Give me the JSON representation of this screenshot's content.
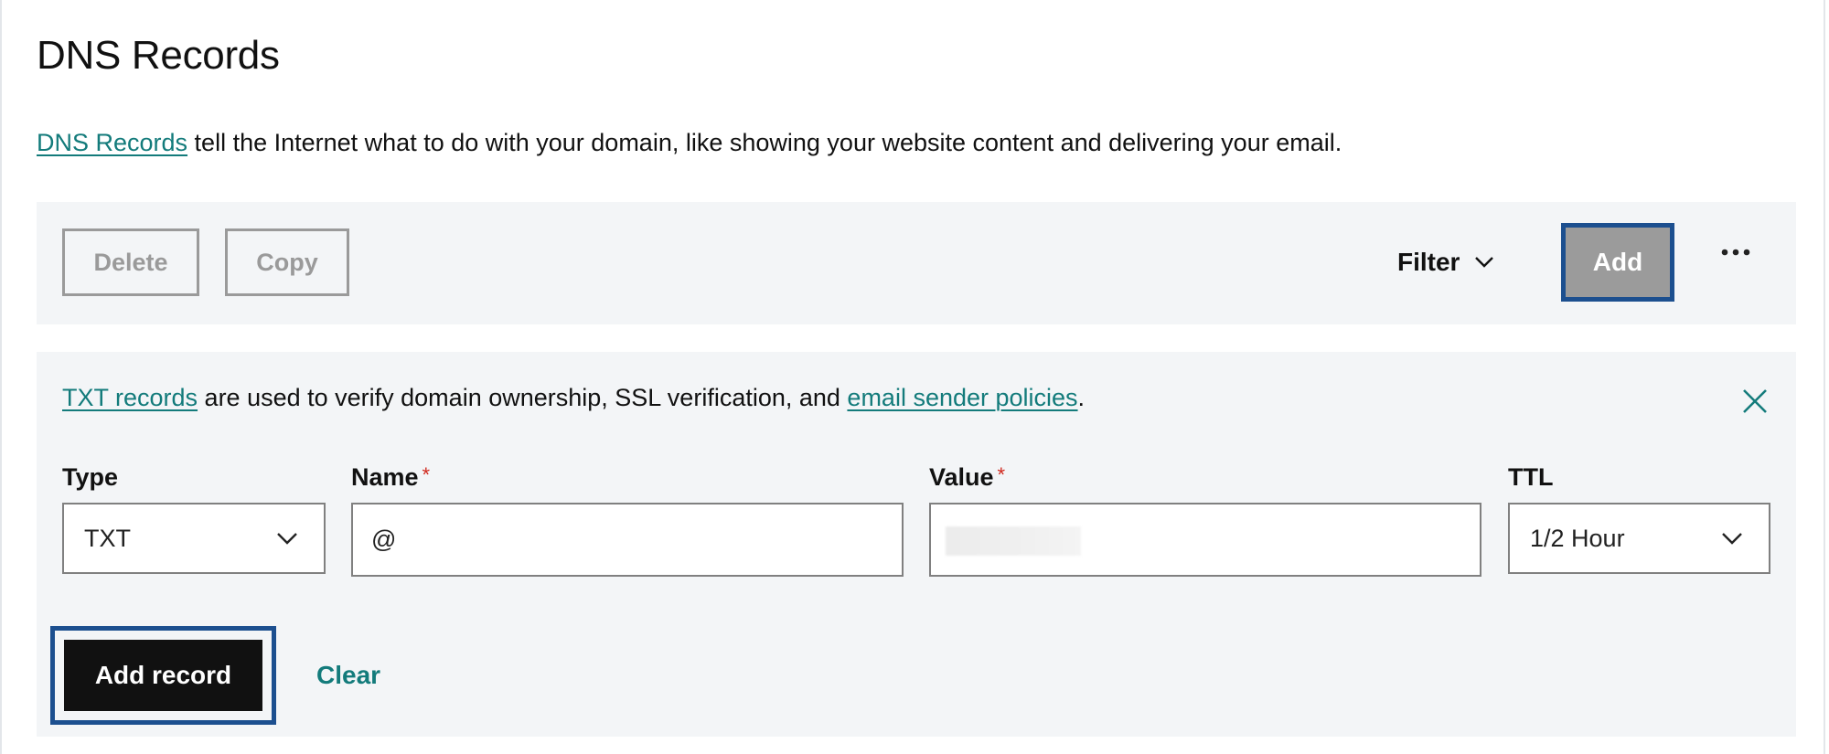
{
  "page": {
    "title": "DNS Records",
    "description": {
      "link_text": "DNS Records",
      "text": " tell the Internet what to do with your domain, like showing your website content and delivering your email."
    }
  },
  "toolbar": {
    "delete_label": "Delete",
    "copy_label": "Copy",
    "filter_label": "Filter",
    "add_label": "Add",
    "more_icon": "ellipsis-icon"
  },
  "add_panel": {
    "info": {
      "link1_text": "TXT records",
      "middle_text": " are used to verify domain ownership, SSL verification, and ",
      "link2_text": "email sender policies",
      "end_text": "."
    },
    "close_icon": "close-icon",
    "fields": {
      "type": {
        "label": "Type",
        "value": "TXT"
      },
      "name": {
        "label": "Name",
        "required_mark": "*",
        "value": "@"
      },
      "value": {
        "label": "Value",
        "required_mark": "*",
        "value": ""
      },
      "ttl": {
        "label": "TTL",
        "value": "1/2 Hour"
      }
    },
    "add_record_label": "Add record",
    "clear_label": "Clear"
  },
  "colors": {
    "link": "#137b7b",
    "focus_ring": "#1c4f8f",
    "panel_bg": "#f3f5f7",
    "required": "#d0281d",
    "primary_button": "#111111",
    "disabled_button": "#9b9b9b"
  }
}
